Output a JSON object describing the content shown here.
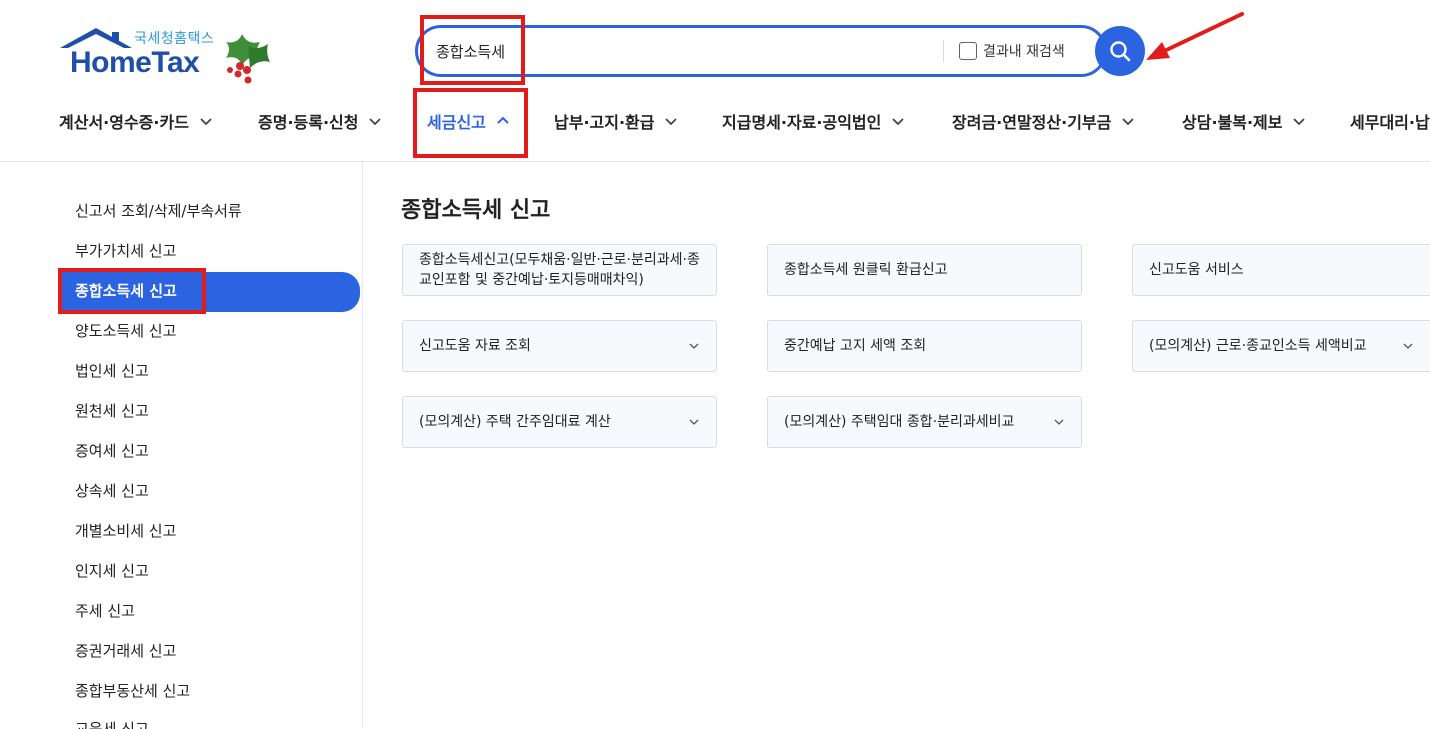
{
  "logo": {
    "sub_text": "국세청홈택스",
    "main_text": "HomeTax"
  },
  "search": {
    "value": "종합소득세",
    "research_label": "결과내 재검색"
  },
  "nav": [
    {
      "label": "계산서·영수증·카드"
    },
    {
      "label": "증명·등록·신청"
    },
    {
      "label": "세금신고"
    },
    {
      "label": "납부·고지·환급"
    },
    {
      "label": "지급명세·자료·공익법인"
    },
    {
      "label": "장려금·연말정산·기부금"
    },
    {
      "label": "상담·불복·제보"
    },
    {
      "label": "세무대리·납"
    }
  ],
  "sidebar": {
    "items": [
      "신고서 조회/삭제/부속서류",
      "부가가치세 신고",
      "종합소득세 신고",
      "양도소득세 신고",
      "법인세 신고",
      "원천세 신고",
      "증여세 신고",
      "상속세 신고",
      "개별소비세 신고",
      "인지세 신고",
      "주세 신고",
      "증권거래세 신고",
      "종합부동산세 신고",
      "교육세 신고"
    ],
    "active_index": 2
  },
  "main": {
    "title": "종합소득세 신고",
    "cards": [
      {
        "label": "종합소득세신고(모두채움·일반·근로·분리과세·종교인포함 및 중간예납·토지등매매차익)"
      },
      {
        "label": "종합소득세 원클릭 환급신고"
      },
      {
        "label": "신고도움 서비스"
      },
      {
        "label": "신고도움 자료 조회"
      },
      {
        "label": "중간예납 고지 세액 조회"
      },
      {
        "label": "(모의계산) 근로·종교인소득 세액비교"
      },
      {
        "label": "(모의계산) 주택 간주임대료 계산"
      },
      {
        "label": "(모의계산) 주택임대 종합·분리과세비교"
      }
    ]
  },
  "colors": {
    "accent": "#2b63e0",
    "highlight": "#e21b1b",
    "card_bg": "#f7f9fc"
  }
}
